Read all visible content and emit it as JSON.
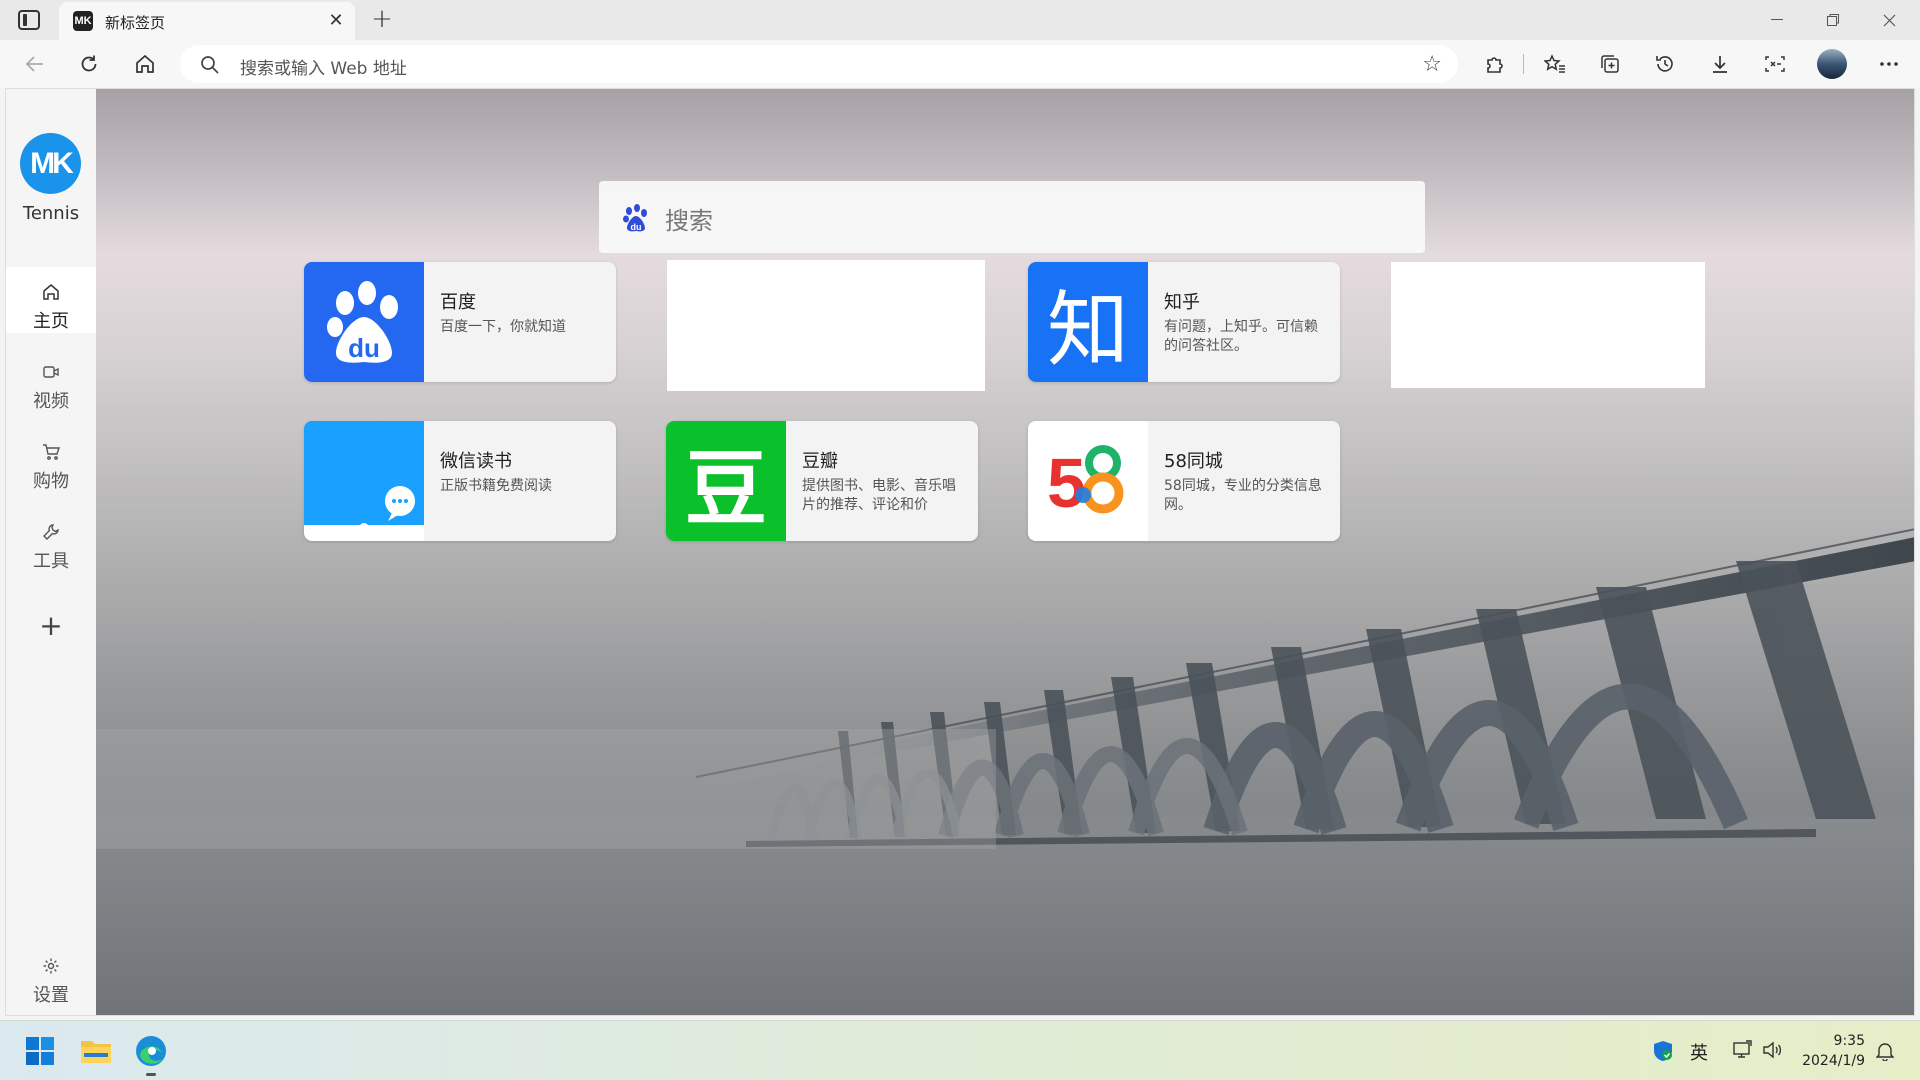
{
  "browser": {
    "tab_title": "新标签页",
    "tab_favicon_text": "MK",
    "address_placeholder": "搜索或输入 Web 地址"
  },
  "sidebar": {
    "profile_name": "Tennis",
    "profile_initials": "MK",
    "items": [
      {
        "label": "主页",
        "icon": "home-icon",
        "active": true
      },
      {
        "label": "视频",
        "icon": "video-icon"
      },
      {
        "label": "购物",
        "icon": "cart-icon"
      },
      {
        "label": "工具",
        "icon": "wrench-icon"
      }
    ],
    "settings_label": "设置"
  },
  "search": {
    "placeholder": "搜索",
    "engine_icon": "baidu-paw-icon"
  },
  "tiles": [
    {
      "name": "百度",
      "desc": "百度一下，你就知道",
      "icon_color": "#2468f2"
    },
    {
      "name": "知乎",
      "desc": "有问题，上知乎。可信赖的问答社区。",
      "icon_text": "知",
      "icon_color": "#1772f6"
    },
    {
      "name": "微信读书",
      "desc": "正版书籍免费阅读",
      "icon_color": "#1aa1ff"
    },
    {
      "name": "豆瓣",
      "desc": "提供图书、电影、音乐唱片的推荐、评论和价",
      "icon_text": "豆",
      "icon_color": "#0ac12c"
    },
    {
      "name": "58同城",
      "desc": "58同城，专业的分类信息网。"
    }
  ],
  "taskbar": {
    "ime_label": "英",
    "time": "9:35",
    "date": "2024/1/9"
  },
  "colors": {
    "accent": "#1a93ea"
  }
}
